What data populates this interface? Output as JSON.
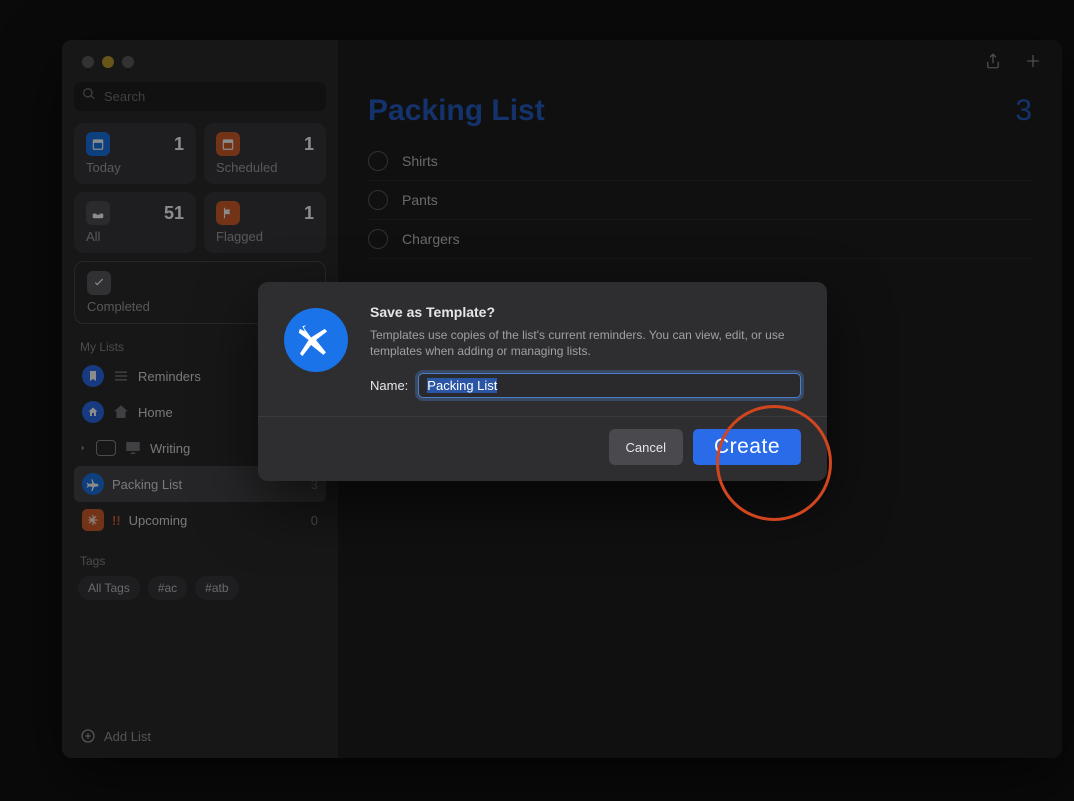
{
  "search": {
    "placeholder": "Search"
  },
  "smart": {
    "today": {
      "label": "Today",
      "count": "1",
      "color": "#1a73e8"
    },
    "scheduled": {
      "label": "Scheduled",
      "count": "1",
      "color": "#cf5e28"
    },
    "all": {
      "label": "All",
      "count": "51",
      "color": "#4f4f53"
    },
    "flagged": {
      "label": "Flagged",
      "count": "1",
      "color": "#cf5e28"
    },
    "completed": {
      "label": "Completed",
      "count": "",
      "color": "#5a5a5e"
    }
  },
  "sections": {
    "mylists": "My Lists",
    "tags": "Tags"
  },
  "mylists": [
    {
      "name": "Reminders",
      "count": "",
      "color": "#2a6bea"
    },
    {
      "name": "Home",
      "count": "",
      "color": "#2a6bea"
    },
    {
      "name": "Writing",
      "count": "",
      "color": "#8a8a8e",
      "expandable": true
    },
    {
      "name": "Packing List",
      "count": "3",
      "color": "#1a73e8",
      "selected": true
    },
    {
      "name": "Upcoming",
      "count": "0",
      "color": "#cf5e28"
    }
  ],
  "tags": [
    "All Tags",
    "#ac",
    "#atb"
  ],
  "footer": {
    "addlist": "Add List"
  },
  "main": {
    "title": "Packing List",
    "count": "3",
    "items": [
      "Shirts",
      "Pants",
      "Chargers"
    ]
  },
  "dialog": {
    "title": "Save as Template?",
    "description": "Templates use copies of the list's current reminders. You can view, edit, or use templates when adding or managing lists.",
    "name_label": "Name:",
    "name_value": "Packing List",
    "cancel": "Cancel",
    "create": "Create"
  }
}
